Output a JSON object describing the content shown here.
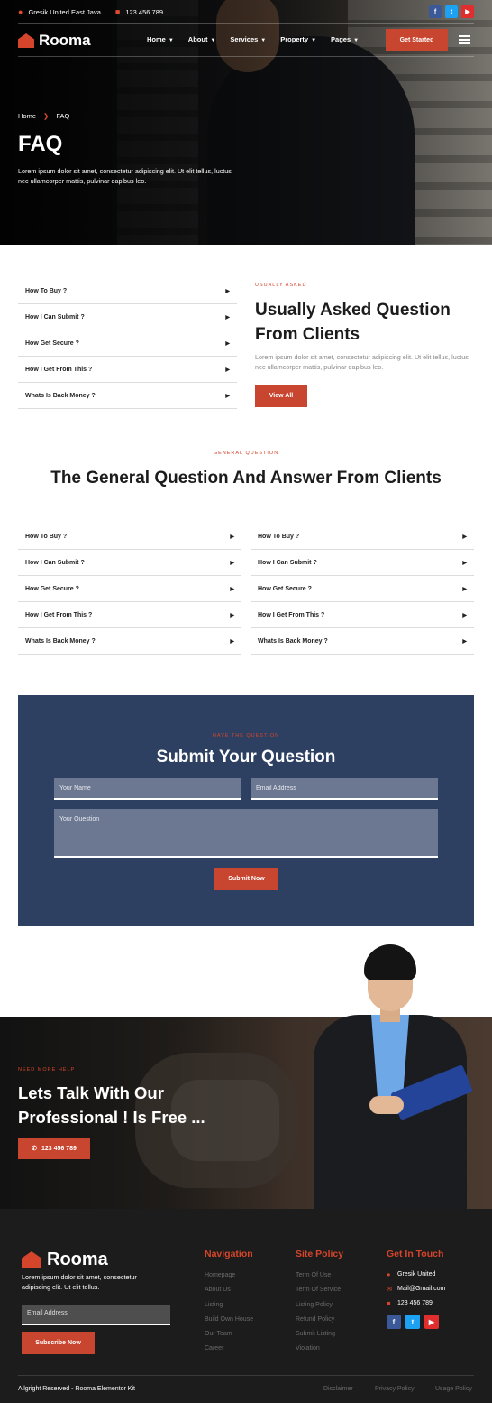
{
  "topbar": {
    "location": "Gresik United East Java",
    "phone": "123 456 789"
  },
  "header": {
    "brand": "Rooma",
    "nav": [
      "Home",
      "About",
      "Services",
      "Property",
      "Pages"
    ],
    "cta": "Get Started"
  },
  "hero": {
    "breadcrumb": [
      "Home",
      "FAQ"
    ],
    "title": "FAQ",
    "description": "Lorem ipsum dolor sit amet, consectetur adipiscing elit. Ut elit tellus, luctus nec ullamcorper mattis, pulvinar dapibus leo."
  },
  "faq_top": {
    "items": [
      "How To Buy ?",
      "How I Can Submit ?",
      "How Get Secure ?",
      "How I Get From This ?",
      "Whats Is Back Money ?"
    ],
    "eyebrow": "USUALLY ASKED",
    "title": "Usually Asked Question From Clients",
    "description": "Lorem ipsum dolor sit amet, consectetur adipiscing elit. Ut elit tellus, luctus nec ullamcorper mattis, pulvinar dapibus leo.",
    "button": "View All"
  },
  "faq_general": {
    "eyebrow": "GENERAL QUESTION",
    "title": "The General Question And Answer From Clients",
    "left": [
      "How To Buy ?",
      "How I Can Submit ?",
      "How Get Secure ?",
      "How I Get From This ?",
      "Whats Is Back Money ?"
    ],
    "right": [
      "How To Buy ?",
      "How I Can Submit ?",
      "How Get Secure ?",
      "How I Get From This ?",
      "Whats Is Back Money ?"
    ]
  },
  "form": {
    "eyebrow": "HAVE THE QUESTION",
    "title": "Submit Your Question",
    "name_placeholder": "Your Name",
    "email_placeholder": "Email Address",
    "question_placeholder": "Your Question",
    "submit": "Submit Now"
  },
  "cta": {
    "eyebrow": "NEED MORE HELP",
    "title": "Lets Talk With Our Professional ! Is Free ...",
    "phone": "123 456 789"
  },
  "footer": {
    "brand": "Rooma",
    "description": "Lorem ipsum dolor sit amet, consectetur adipiscing elit. Ut elit tellus.",
    "email_placeholder": "Email Address",
    "subscribe": "Subscribe Now",
    "nav_title": "Navigation",
    "nav": [
      "Homepage",
      "About Us",
      "Listing",
      "Build Own House",
      "Our Team",
      "Career"
    ],
    "policy_title": "Site Policy",
    "policy": [
      "Term Of Use",
      "Term Of Service",
      "Listing Policy",
      "Refund Policy",
      "Submit Listing",
      "Violation"
    ],
    "contact_title": "Get In Touch",
    "contact": {
      "location": "Gresik United",
      "email": "Mail@Gmail.com",
      "phone": "123 456 789"
    },
    "copyright": "Allgright Reserved - Rooma Elementor Kit",
    "legal": [
      "Disclaimer",
      "Privacy Policy",
      "Usage Policy"
    ]
  },
  "colors": {
    "accent": "#c8452f",
    "navy": "#2e4062",
    "footer": "#1c1c1c"
  },
  "icons": [
    "map-pin-icon",
    "phone-icon",
    "facebook-icon",
    "twitter-icon",
    "youtube-icon",
    "chevron-down-icon",
    "hamburger-icon",
    "caret-right-icon",
    "envelope-icon"
  ]
}
